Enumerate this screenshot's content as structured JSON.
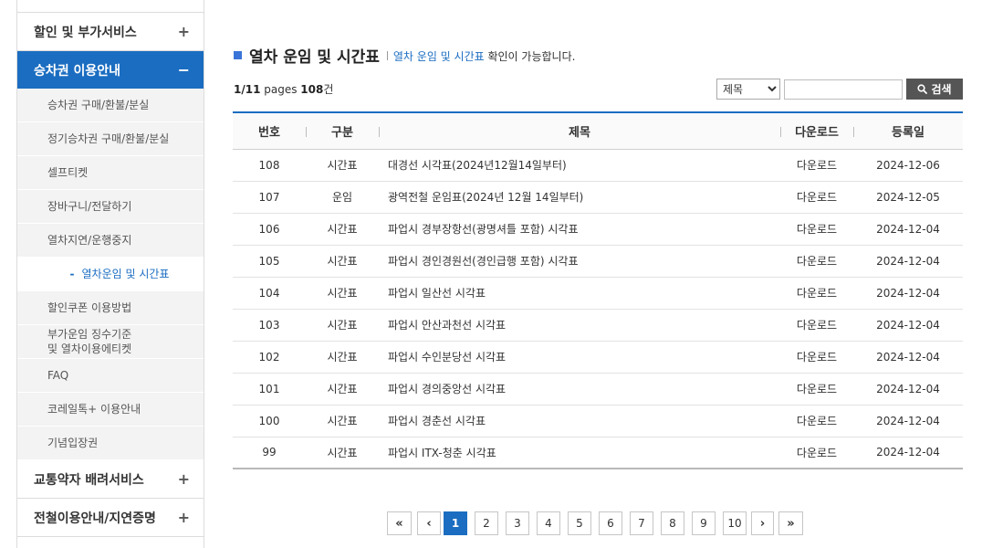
{
  "colors": {
    "accent": "#1b6dc1",
    "title_square": "#3a74d8",
    "search_button": "#555555",
    "submenu_bg": "#f3f3f3"
  },
  "sidebar": {
    "menus": [
      {
        "label": "할인 및 부가서비스",
        "toggle": "+",
        "expanded": false
      },
      {
        "label": "승차권 이용안내",
        "toggle": "−",
        "expanded": true
      },
      {
        "label": "교통약자 배려서비스",
        "toggle": "+",
        "expanded": false
      },
      {
        "label": "전철이용안내/지연증명",
        "toggle": "+",
        "expanded": false
      }
    ],
    "sub_items": [
      {
        "lines": [
          "승차권 구매/환불/분실"
        ]
      },
      {
        "lines": [
          "정기승차권 구매/환불/분실"
        ]
      },
      {
        "lines": [
          "셀프티켓"
        ]
      },
      {
        "lines": [
          "장바구니/전달하기"
        ]
      },
      {
        "lines": [
          "열차지연/운행중지"
        ]
      },
      {
        "lines": [
          "열차운임 및 시간표"
        ],
        "active": true,
        "marker": "-"
      },
      {
        "lines": [
          "할인쿠폰 이용방법"
        ]
      },
      {
        "lines": [
          "부가운임 징수기준",
          "및 열차이용에티켓"
        ]
      },
      {
        "lines": [
          "FAQ"
        ]
      },
      {
        "lines": [
          "코레일톡+ 이용안내"
        ]
      },
      {
        "lines": [
          "기념입장권"
        ]
      }
    ]
  },
  "page_header": {
    "title": "열차 운임 및 시간표",
    "desc_highlight": "열차 운임 및 시간표",
    "desc_rest": " 확인이 가능합니다."
  },
  "listing": {
    "page_info": "1/11",
    "pages_label": " pages ",
    "total_count": "108",
    "count_unit": "건"
  },
  "search": {
    "selected_field": "제목",
    "button_label": "검색",
    "button_icon": "search-icon"
  },
  "table": {
    "columns": {
      "no": "번호",
      "category": "구분",
      "title": "제목",
      "download": "다운로드",
      "date": "등록일"
    },
    "rows": [
      {
        "no": "108",
        "category": "시간표",
        "title": "대경선 시각표(2024년12월14일부터)",
        "download": "다운로드",
        "date": "2024-12-06"
      },
      {
        "no": "107",
        "category": "운임",
        "title": "광역전철 운임표(2024년 12월 14일부터)",
        "download": "다운로드",
        "date": "2024-12-05"
      },
      {
        "no": "106",
        "category": "시간표",
        "title": "파업시 경부장항선(광명셔틀 포함) 시각표",
        "download": "다운로드",
        "date": "2024-12-04"
      },
      {
        "no": "105",
        "category": "시간표",
        "title": "파업시 경인경원선(경인급행 포함) 시각표",
        "download": "다운로드",
        "date": "2024-12-04"
      },
      {
        "no": "104",
        "category": "시간표",
        "title": "파업시 일산선 시각표",
        "download": "다운로드",
        "date": "2024-12-04"
      },
      {
        "no": "103",
        "category": "시간표",
        "title": "파업시 안산과천선 시각표",
        "download": "다운로드",
        "date": "2024-12-04"
      },
      {
        "no": "102",
        "category": "시간표",
        "title": "파업시 수인분당선 시각표",
        "download": "다운로드",
        "date": "2024-12-04"
      },
      {
        "no": "101",
        "category": "시간표",
        "title": "파업시 경의중앙선 시각표",
        "download": "다운로드",
        "date": "2024-12-04"
      },
      {
        "no": "100",
        "category": "시간표",
        "title": "파업시 경춘선 시각표",
        "download": "다운로드",
        "date": "2024-12-04"
      },
      {
        "no": "99",
        "category": "시간표",
        "title": "파업시 ITX-청춘 시각표",
        "download": "다운로드",
        "date": "2024-12-04"
      }
    ]
  },
  "pagination": {
    "first": "«",
    "prev": "‹",
    "pages": [
      "1",
      "2",
      "3",
      "4",
      "5",
      "6",
      "7",
      "8",
      "9",
      "10"
    ],
    "current_page": 1,
    "next": "›",
    "last": "»"
  }
}
